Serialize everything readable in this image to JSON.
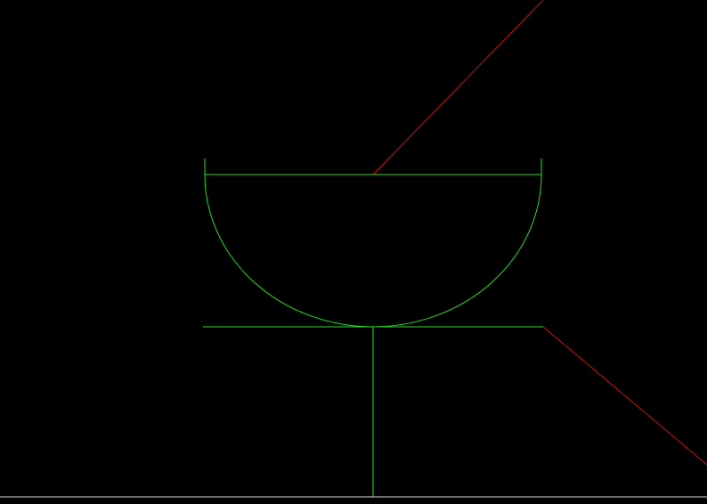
{
  "colors": {
    "background": "#000000",
    "primary_stroke": "#22dd22",
    "secondary_stroke": "#cc1111",
    "baseline_stroke": "#dddddd"
  }
}
